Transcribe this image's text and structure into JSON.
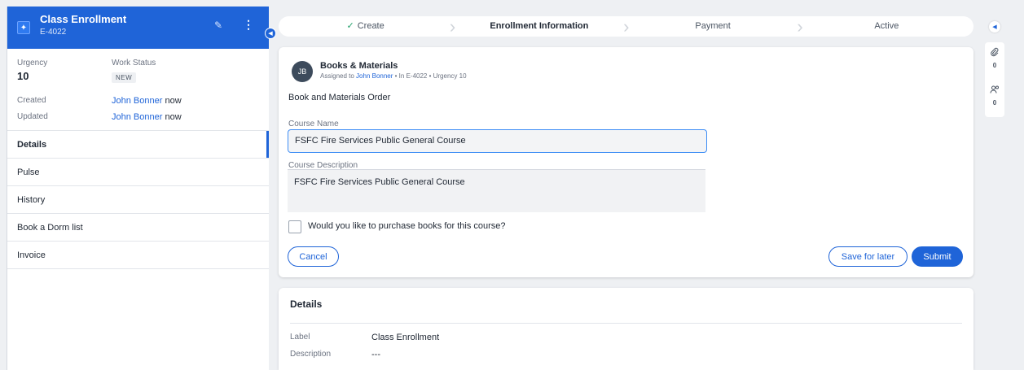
{
  "case": {
    "title": "Class Enrollment",
    "id": "E-4022",
    "urgency_label": "Urgency",
    "urgency_value": "10",
    "work_status_label": "Work Status",
    "work_status_value": "NEW",
    "created_label": "Created",
    "created_user": "John Bonner",
    "created_time": "now",
    "updated_label": "Updated",
    "updated_user": "John Bonner",
    "updated_time": "now"
  },
  "nav": {
    "items": [
      {
        "label": "Details"
      },
      {
        "label": "Pulse"
      },
      {
        "label": "History"
      },
      {
        "label": "Book a Dorm list"
      },
      {
        "label": "Invoice"
      }
    ]
  },
  "stages": [
    {
      "label": "Create"
    },
    {
      "label": "Enrollment Information"
    },
    {
      "label": "Payment"
    },
    {
      "label": "Active"
    }
  ],
  "task": {
    "avatar_initials": "JB",
    "title": "Books & Materials",
    "assigned_prefix": "Assigned to",
    "assigned_user": "John Bonner",
    "assigned_suffix": "• In E-4022 • Urgency 10",
    "form_title": "Book and Materials Order",
    "course_name_label": "Course Name",
    "course_name_value": "FSFC Fire Services Public General Course",
    "course_desc_label": "Course Description",
    "course_desc_value": "FSFC Fire Services Public General Course",
    "checkbox_label": "Would you like to purchase books for this course?",
    "cancel_label": "Cancel",
    "save_label": "Save for later",
    "submit_label": "Submit"
  },
  "details": {
    "title": "Details",
    "label_label": "Label",
    "label_value": "Class Enrollment",
    "desc_label": "Description",
    "desc_value": "---"
  },
  "rail": {
    "attachments_count": "0",
    "followers_count": "0"
  },
  "colors": {
    "accent": "#1f64d8",
    "success": "#22a06b"
  }
}
